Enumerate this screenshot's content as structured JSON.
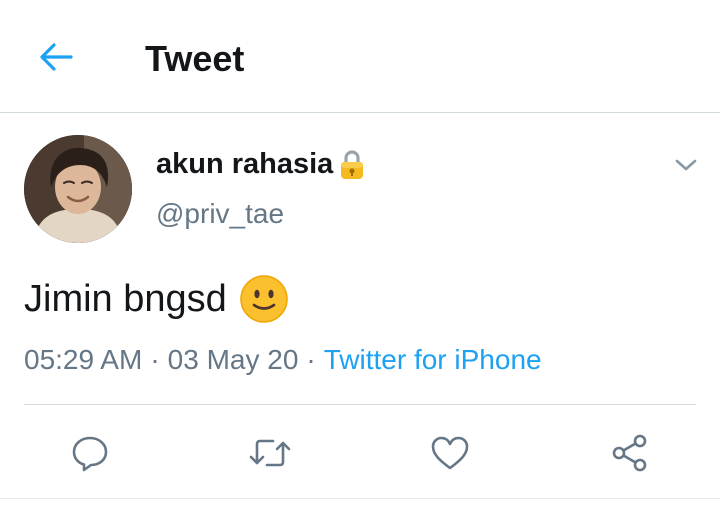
{
  "header": {
    "title": "Tweet",
    "back_icon": "arrow-left-icon"
  },
  "tweet": {
    "author": {
      "display_name": "akun rahasia",
      "handle": "@priv_tae",
      "protected_icon": "lock-icon"
    },
    "text": "Jimin bngsd",
    "emoji": "slightly-smiling-face",
    "time": "05:29 AM",
    "date": "03 May 20",
    "separator": "·",
    "source": "Twitter for iPhone"
  },
  "actions": [
    "reply-icon",
    "retweet-icon",
    "like-icon",
    "share-icon"
  ],
  "colors": {
    "accent": "#1da1f2",
    "text": "#14171a",
    "secondary": "#657786",
    "border": "#cfd9de"
  }
}
